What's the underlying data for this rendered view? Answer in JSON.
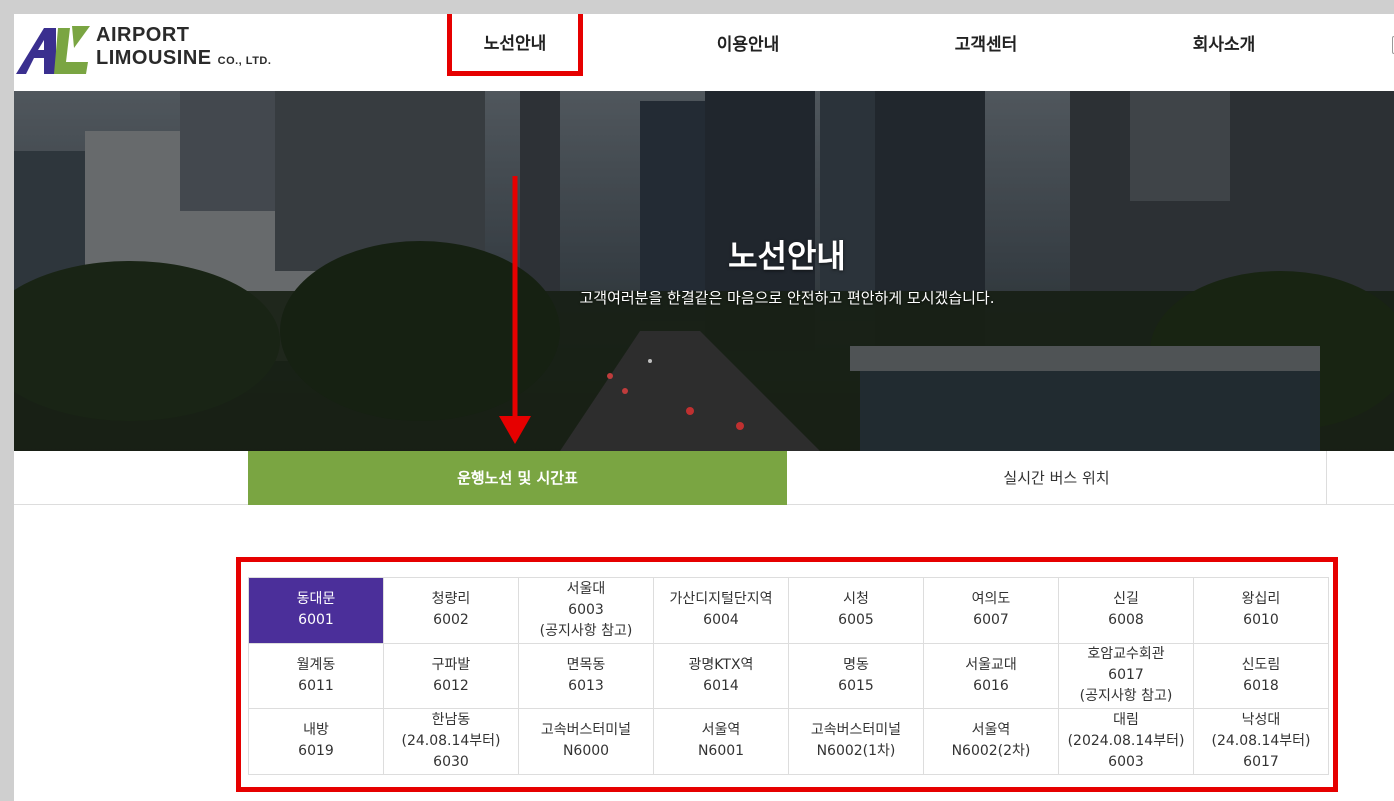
{
  "logo": {
    "line1": "AIRPORT",
    "line2": "LIMOUSINE",
    "suffix": "CO., LTD."
  },
  "nav": {
    "routes": "노선안내",
    "usage": "이용안내",
    "service": "고객센터",
    "about": "회사소개"
  },
  "hero": {
    "title": "노선안내",
    "subtitle": "고객여러분을 한결같은 마음으로 안전하고 편안하게 모시겠습니다."
  },
  "tabs": {
    "timetable": "운행노선 및 시간표",
    "realtime": "실시간 버스 위치"
  },
  "routes": [
    [
      {
        "name": "동대문",
        "code": "6001",
        "active": true
      },
      {
        "name": "청량리",
        "code": "6002"
      },
      {
        "name": "서울대",
        "code": "6003",
        "note": "(공지사항 참고)"
      },
      {
        "name": "가산디지털단지역",
        "code": "6004"
      },
      {
        "name": "시청",
        "code": "6005"
      },
      {
        "name": "여의도",
        "code": "6007"
      },
      {
        "name": "신길",
        "code": "6008"
      },
      {
        "name": "왕십리",
        "code": "6010"
      }
    ],
    [
      {
        "name": "월계동",
        "code": "6011"
      },
      {
        "name": "구파발",
        "code": "6012"
      },
      {
        "name": "면목동",
        "code": "6013"
      },
      {
        "name": "광명KTX역",
        "code": "6014"
      },
      {
        "name": "명동",
        "code": "6015"
      },
      {
        "name": "서울교대",
        "code": "6016"
      },
      {
        "name": "호암교수회관",
        "code": "6017",
        "note": "(공지사항 참고)"
      },
      {
        "name": "신도림",
        "code": "6018"
      }
    ],
    [
      {
        "name": "내방",
        "code": "6019"
      },
      {
        "name": "한남동",
        "note": "(24.08.14부터)",
        "code": "6030",
        "noteFirst": true
      },
      {
        "name": "고속버스터미널",
        "code": "N6000"
      },
      {
        "name": "서울역",
        "code": "N6001"
      },
      {
        "name": "고속버스터미널",
        "code": "N6002(1차)"
      },
      {
        "name": "서울역",
        "code": "N6002(2차)"
      },
      {
        "name": "대림",
        "note": "(2024.08.14부터)",
        "code": "6003",
        "noteFirst": true
      },
      {
        "name": "낙성대",
        "note": "(24.08.14부터)",
        "code": "6017",
        "noteFirst": true
      }
    ]
  ],
  "colors": {
    "active_tab": "#7aa542",
    "active_route": "#4b2f9a",
    "highlight": "#e60000"
  }
}
